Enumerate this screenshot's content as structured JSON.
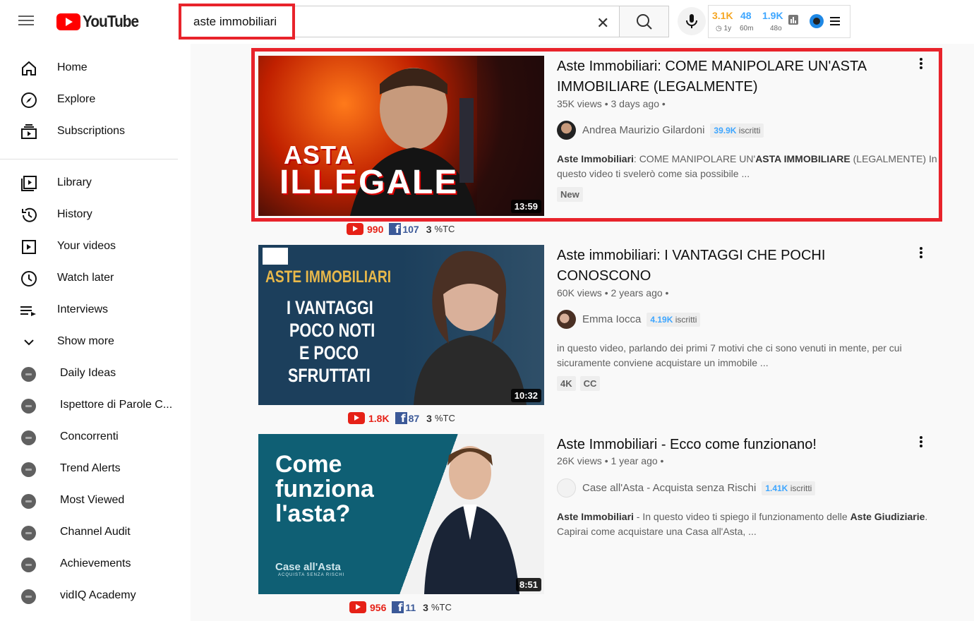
{
  "header": {
    "logo_text": "YouTube"
  },
  "search": {
    "query": "aste immobiliari"
  },
  "vidiq": {
    "stats": [
      {
        "value": "3.1K",
        "sub": "1y",
        "color": "#f5a623"
      },
      {
        "value": "48",
        "sub": "60m",
        "color": "#3ea6ff"
      },
      {
        "value": "1.9K",
        "sub": "48o",
        "color": "#3ea6ff"
      }
    ]
  },
  "sidebar": {
    "main": [
      {
        "label": "Home",
        "icon": "home-icon"
      },
      {
        "label": "Explore",
        "icon": "compass-icon"
      },
      {
        "label": "Subscriptions",
        "icon": "subscriptions-icon"
      }
    ],
    "library": [
      {
        "label": "Library",
        "icon": "library-icon"
      },
      {
        "label": "History",
        "icon": "history-icon"
      },
      {
        "label": "Your videos",
        "icon": "your-videos-icon"
      },
      {
        "label": "Watch later",
        "icon": "watch-later-icon"
      },
      {
        "label": "Interviews",
        "icon": "playlist-icon"
      },
      {
        "label": "Show more",
        "icon": "chevron-down-icon"
      }
    ],
    "channels": [
      {
        "label": "Daily Ideas"
      },
      {
        "label": "Ispettore di Parole C..."
      },
      {
        "label": "Concorrenti"
      },
      {
        "label": "Trend Alerts"
      },
      {
        "label": "Most Viewed"
      },
      {
        "label": "Channel Audit"
      },
      {
        "label": "Achievements"
      },
      {
        "label": "vidIQ Academy"
      }
    ]
  },
  "results": [
    {
      "title": "Aste Immobiliari: COME MANIPOLARE UN'ASTA IMMOBILIARE (LEGALMENTE)",
      "views": "35K views",
      "age": "3 days ago",
      "channel": "Andrea Maurizio Gilardoni",
      "subs_num": "39.9K",
      "subs_word": "iscritti",
      "desc_parts": [
        {
          "b": "Aste Immobiliari",
          "t": ": COME MANIPOLARE UN'"
        },
        {
          "b": "ASTA IMMOBILIARE",
          "t": " (LEGALMENTE) In questo video ti svelerò come sia possibile ..."
        }
      ],
      "badges": [
        "New"
      ],
      "duration": "13:59",
      "thumb_text": [
        "ASTA",
        "ILLEGALE"
      ],
      "stats": {
        "yt": "990",
        "fb": "107",
        "tc_num": "3",
        "tc_label": "%TC"
      }
    },
    {
      "title": "Aste immobiliari: I VANTAGGI CHE POCHI CONOSCONO",
      "views": "60K views",
      "age": "2 years ago",
      "channel": "Emma Iocca",
      "subs_num": "4.19K",
      "subs_word": "iscritti",
      "desc_plain": "in questo video, parlando dei primi 7 motivi che ci sono venuti in mente, per cui sicuramente conviene acquistare un immobile ...",
      "badges": [
        "4K",
        "CC"
      ],
      "duration": "10:32",
      "thumb_text": [
        "ASTE IMMOBILIARI",
        "I VANTAGGI",
        "POCO NOTI",
        "E POCO",
        "SFRUTTATI"
      ],
      "stats": {
        "yt": "1.8K",
        "fb": "87",
        "tc_num": "3",
        "tc_label": "%TC"
      }
    },
    {
      "title": "Aste Immobiliari - Ecco come funzionano!",
      "views": "26K views",
      "age": "1 year ago",
      "channel": "Case all'Asta - Acquista senza Rischi",
      "subs_num": "1.41K",
      "subs_word": "iscritti",
      "desc_parts": [
        {
          "b": "Aste Immobiliari",
          "t": " - In questo video ti spiego il funzionamento delle "
        },
        {
          "b": "Aste Giudiziarie",
          "t": ". Capirai come acquistare una Casa all'Asta, ..."
        }
      ],
      "badges": [],
      "duration": "8:51",
      "thumb_text": [
        "Come",
        "funziona",
        "l'asta?",
        "Case all'Asta",
        "ACQUISTA SENZA RISCHI"
      ],
      "stats": {
        "yt": "956",
        "fb": "11",
        "tc_num": "3",
        "tc_label": "%TC"
      }
    }
  ]
}
